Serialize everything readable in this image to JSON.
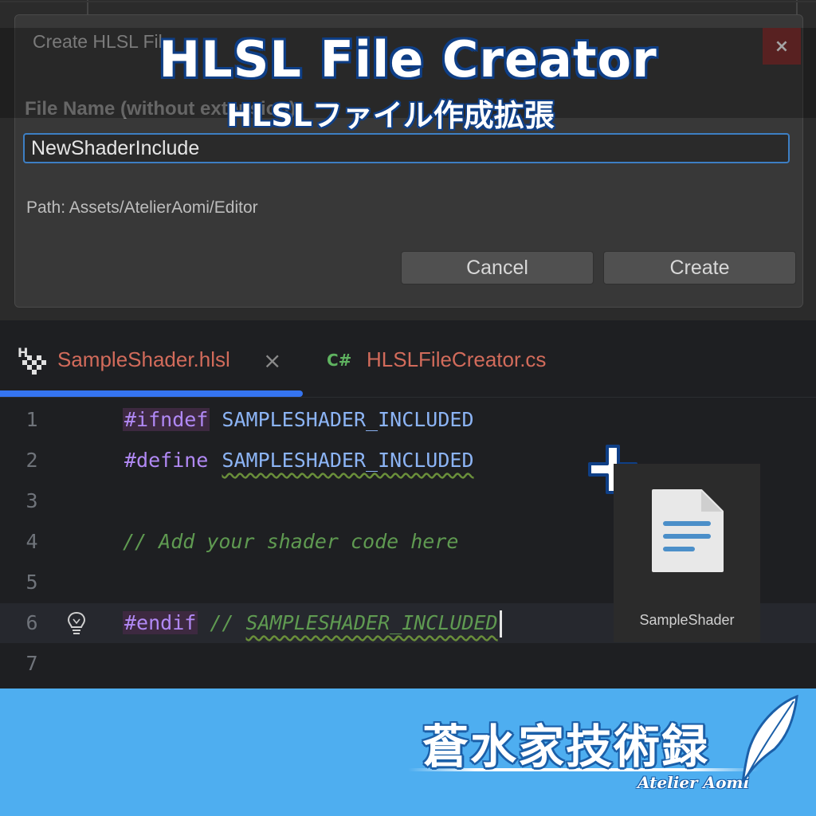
{
  "overlay": {
    "title": "HLSL File Creator",
    "subtitle": "HLSLファイル作成拡張"
  },
  "dialog": {
    "title": "Create HLSL File",
    "close_label": "×",
    "field_label": "File Name (without extension):",
    "file_name_value": "NewShaderInclude",
    "path_text": "Path: Assets/AtelierAomi/Editor",
    "cancel_label": "Cancel",
    "create_label": "Create"
  },
  "editor": {
    "tabs": [
      {
        "label": "SampleShader.hlsl",
        "icon": "hlsl-file-icon",
        "active": true,
        "close_label": "×"
      },
      {
        "label": "HLSLFileCreator.cs",
        "icon_text": "C#",
        "active": false
      }
    ],
    "lines": [
      {
        "num": "1",
        "pp": "#ifndef",
        "ident": "SAMPLESHADER_INCLUDED"
      },
      {
        "num": "2",
        "pp": "#define",
        "ident": "SAMPLESHADER_INCLUDED"
      },
      {
        "num": "3"
      },
      {
        "num": "4",
        "comment": "// Add your shader code here"
      },
      {
        "num": "5"
      },
      {
        "num": "6",
        "pp": "#endif",
        "comment_prefix": "// ",
        "comment_ident": "SAMPLESHADER_INCLUDED"
      },
      {
        "num": "7"
      }
    ]
  },
  "file_card": {
    "label": "SampleShader"
  },
  "brand": {
    "name": "蒼水家技術録",
    "sub": "Atelier Aomi"
  },
  "colors": {
    "accent_blue": "#3574f0",
    "title_outline": "#0f3f86",
    "footer_bg": "#4eaef0",
    "tab_text": "#d26b5b"
  }
}
